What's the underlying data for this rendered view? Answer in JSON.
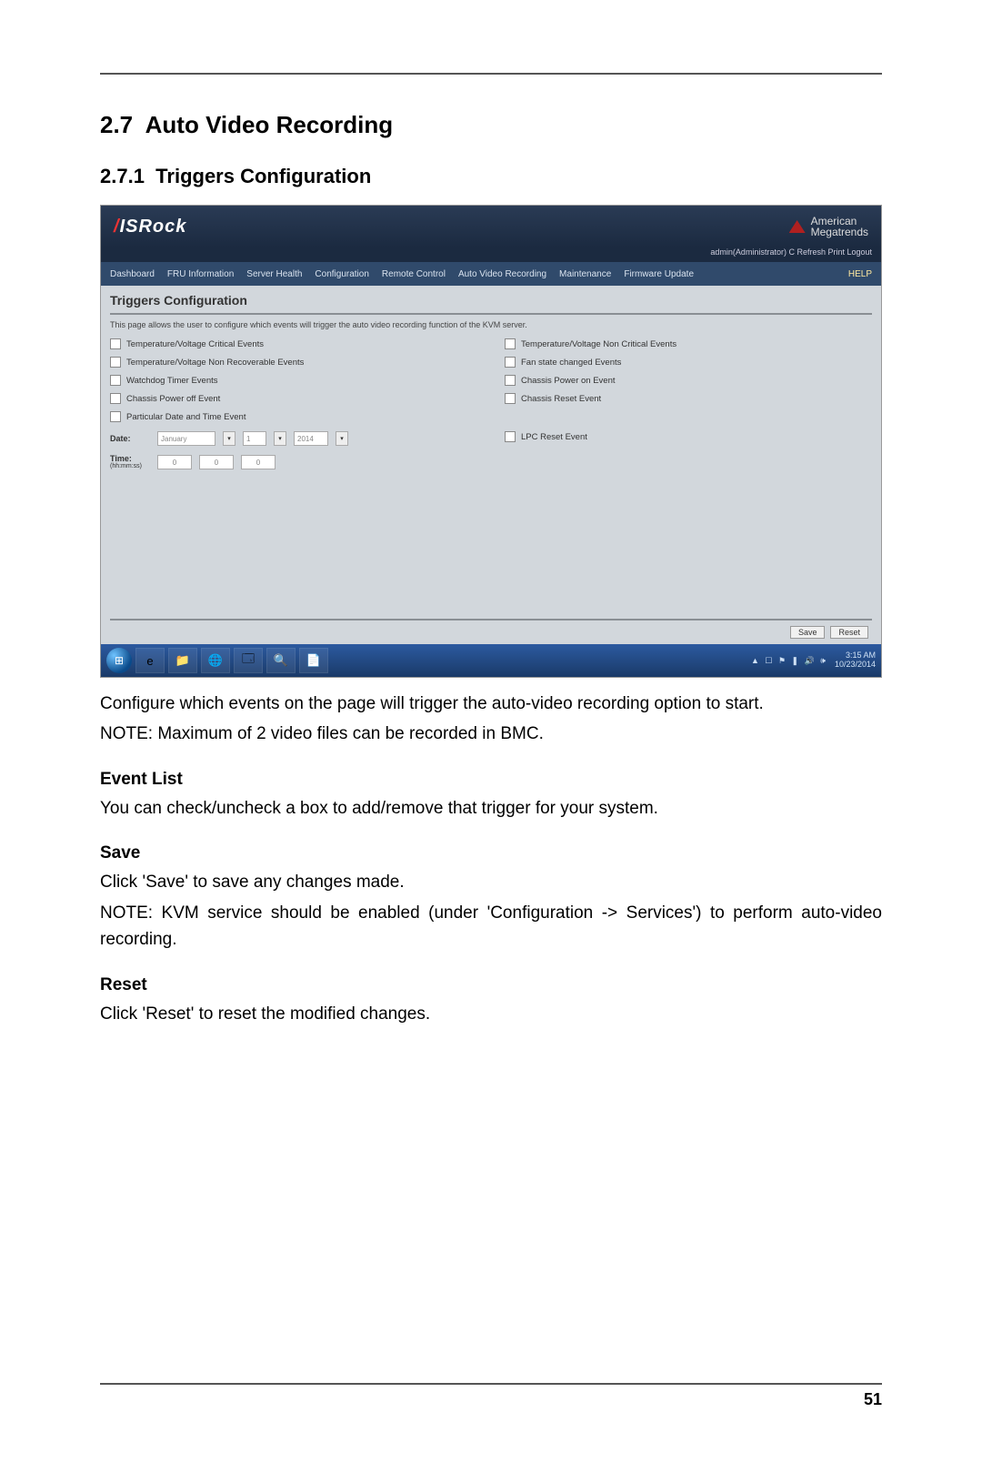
{
  "section_number": "2.7",
  "section_title": "Auto Video Recording",
  "subsection_number": "2.7.1",
  "subsection_title": "Triggers Configuration",
  "page_number": "51",
  "body": {
    "intro": "Configure which events on the page will trigger the auto-video recording option to start.",
    "intro_note": "NOTE: Maximum of 2 video files can be recorded in BMC.",
    "event_list_h": "Event List",
    "event_list_p": "You can check/uncheck a box to add/remove that trigger for your system.",
    "save_h": "Save",
    "save_p1": "Click 'Save' to save any changes made.",
    "save_p2": "NOTE: KVM service should be enabled (under 'Configuration -> Services') to perform auto-video recording.",
    "reset_h": "Reset",
    "reset_p": "Click 'Reset' to reset the modified changes."
  },
  "ss": {
    "brand": "/ISRock",
    "ami1": "American",
    "ami2": "Megatrends",
    "subheader": "admin(Administrator)   C Refresh   Print   Logout",
    "nav": {
      "n1": "Dashboard",
      "n2": "FRU Information",
      "n3": "Server Health",
      "n4": "Configuration",
      "n5": "Remote Control",
      "n6": "Auto Video Recording",
      "n7": "Maintenance",
      "n8": "Firmware Update",
      "help": "HELP"
    },
    "title": "Triggers Configuration",
    "desc": "This page allows the user to configure which events will trigger the auto video recording function of the KVM server.",
    "left": {
      "c1": "Temperature/Voltage Critical Events",
      "c2": "Temperature/Voltage Non Recoverable Events",
      "c3": "Watchdog Timer Events",
      "c4": "Chassis Power off Event",
      "c5": "Particular Date and Time Event"
    },
    "right": {
      "c1": "Temperature/Voltage Non Critical Events",
      "c2": "Fan state changed Events",
      "c3": "Chassis Power on Event",
      "c4": "Chassis Reset Event",
      "c5": "LPC Reset Event"
    },
    "date_lbl": "Date:",
    "date_month": "January",
    "date_day": "1",
    "date_year": "2014",
    "time_lbl": "Time:",
    "time_hint": "(hh:mm:ss)",
    "time_h": "0",
    "time_m": "0",
    "time_s": "0",
    "save": "Save",
    "reset": "Reset",
    "clock1": "3:15 AM",
    "clock2": "10/23/2014",
    "tray": "▲ ☐ ⚑ ❚ 🔊 🕪"
  }
}
